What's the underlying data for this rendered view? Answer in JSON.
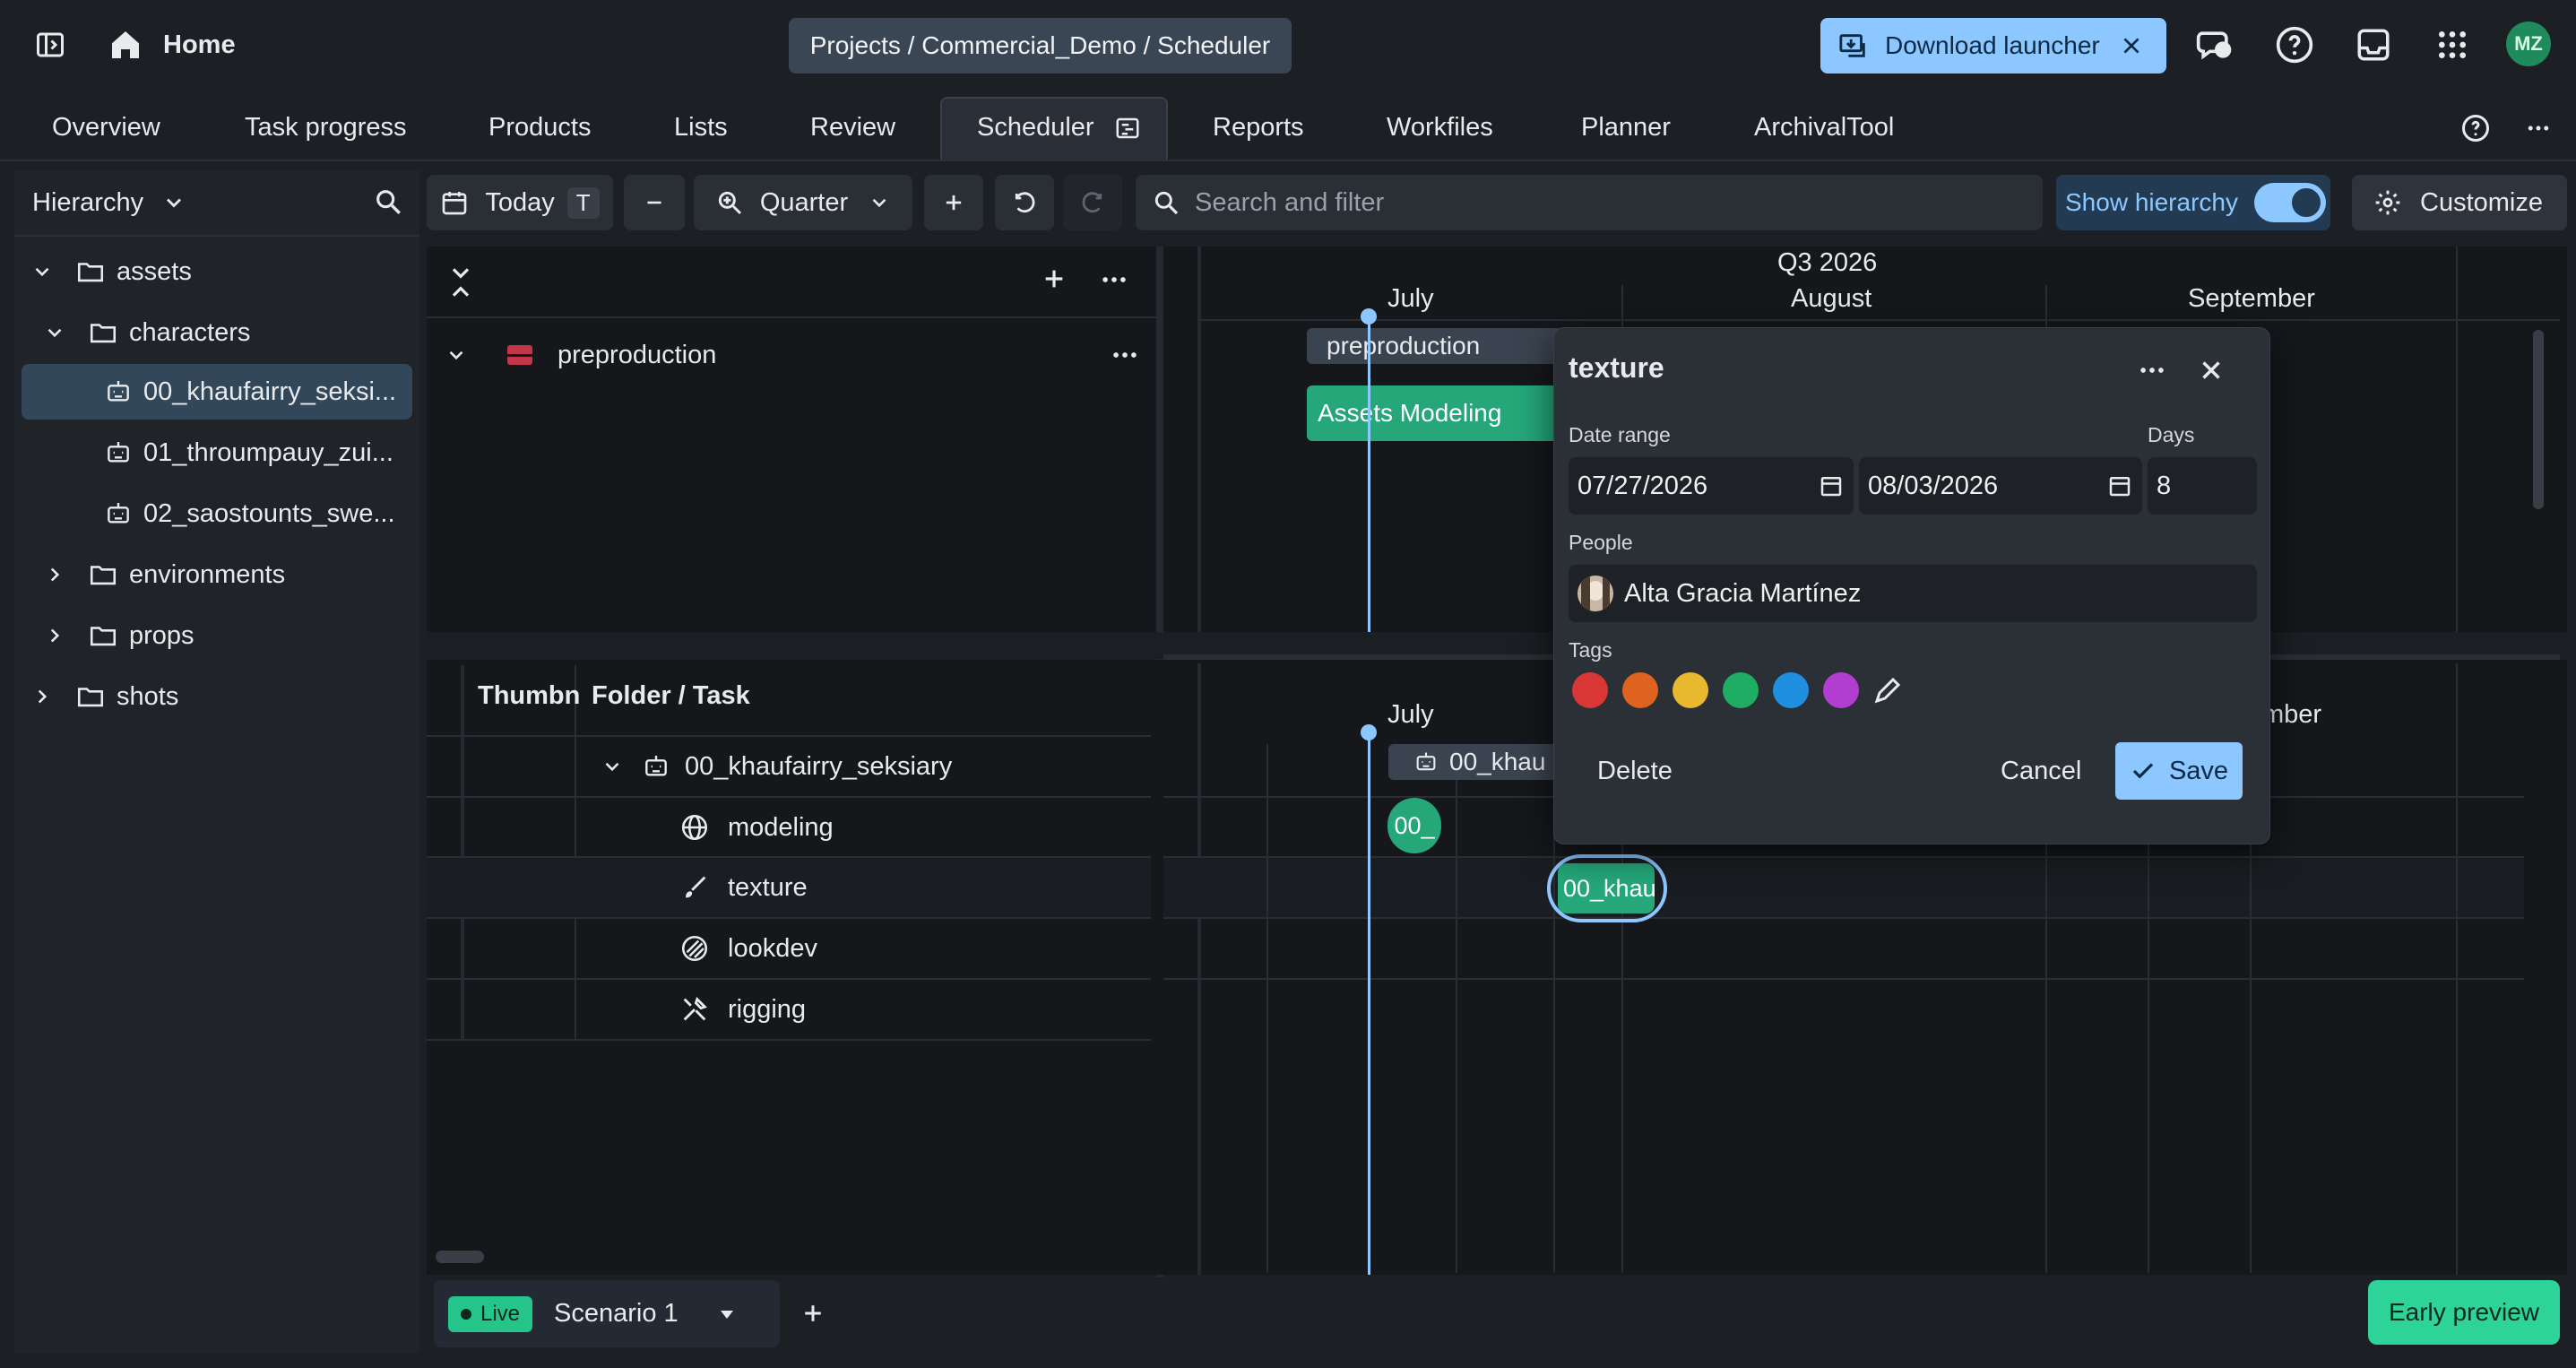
{
  "topbar": {
    "home_label": "Home",
    "breadcrumb": "Projects / Commercial_Demo / Scheduler",
    "download_label": "Download launcher",
    "avatar_initials": "MZ"
  },
  "tabs": [
    {
      "label": "Overview"
    },
    {
      "label": "Task progress"
    },
    {
      "label": "Products"
    },
    {
      "label": "Lists"
    },
    {
      "label": "Review"
    },
    {
      "label": "Scheduler",
      "active": true
    },
    {
      "label": "Reports"
    },
    {
      "label": "Workfiles"
    },
    {
      "label": "Planner"
    },
    {
      "label": "ArchivalTool"
    }
  ],
  "sidebar": {
    "title": "Hierarchy",
    "items": [
      {
        "label": "assets",
        "level": 0,
        "expanded": true
      },
      {
        "label": "characters",
        "level": 1,
        "expanded": true
      },
      {
        "label": "00_khaufairry_seksi...",
        "level": 2,
        "selected": true
      },
      {
        "label": "01_throumpauy_zui...",
        "level": 2
      },
      {
        "label": "02_saostounts_swe...",
        "level": 2
      },
      {
        "label": "environments",
        "level": 1
      },
      {
        "label": "props",
        "level": 1
      },
      {
        "label": "shots",
        "level": 0
      }
    ]
  },
  "toolbar": {
    "today_label": "Today",
    "today_shortcut": "T",
    "zoom_label": "Quarter",
    "search_placeholder": "Search and filter",
    "show_hierarchy_label": "Show hierarchy",
    "customize_label": "Customize"
  },
  "timeline": {
    "quarter_label": "Q3 2026",
    "months_top": [
      "July",
      "August",
      "September"
    ],
    "month_lower_left": "July",
    "month_lower_right": "mber"
  },
  "upper_pane": {
    "row_label": "preproduction",
    "bar_preproduction": "preproduction",
    "bar_assets": "Assets Modeling"
  },
  "lower_pane": {
    "col_thumb": "Thumbn",
    "col_folder": "Folder / Task",
    "rows": [
      {
        "label": "00_khaufairry_seksiary",
        "icon": "asset-icon"
      },
      {
        "label": "modeling",
        "icon": "globe-icon"
      },
      {
        "label": "texture",
        "icon": "brush-icon"
      },
      {
        "label": "lookdev",
        "icon": "lookdev-icon"
      },
      {
        "label": "rigging",
        "icon": "tools-icon"
      }
    ],
    "bar_folder": "00_khau",
    "bar_modeling": "00_",
    "bar_texture": "00_khau"
  },
  "popover": {
    "title": "texture",
    "date_range_label": "Date range",
    "start_date": "07/27/2026",
    "end_date": "08/03/2026",
    "days_label": "Days",
    "days_value": "8",
    "people_label": "People",
    "person_name": "Alta Gracia Martínez",
    "tags_label": "Tags",
    "tag_colors": [
      "#d93636",
      "#e0621f",
      "#e8b92e",
      "#1fad63",
      "#1f8fe0",
      "#b23ed1"
    ],
    "delete_label": "Delete",
    "cancel_label": "Cancel",
    "save_label": "Save"
  },
  "bottom": {
    "live_label": "Live",
    "scenario_label": "Scenario 1",
    "early_preview_label": "Early preview"
  },
  "colors": {
    "accent": "#8cc8ff",
    "task_green": "#25a77a",
    "today_line": "#8cc8ff"
  }
}
